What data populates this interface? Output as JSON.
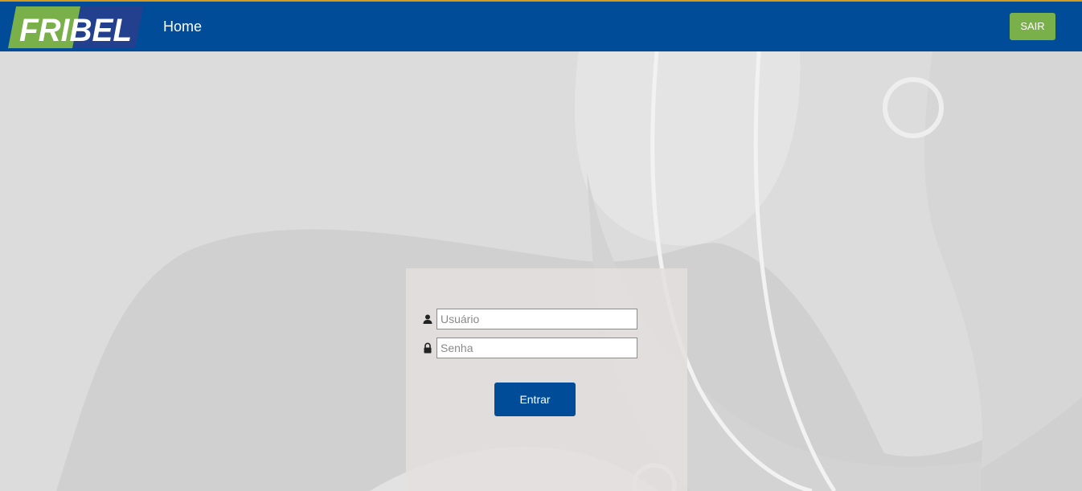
{
  "brand": {
    "logo_text": "FRIBEL",
    "colors": {
      "navbar": "#004c98",
      "logo_green": "#7ab04a",
      "logo_navy": "#23408e",
      "top_border": "#d49a1c"
    }
  },
  "nav": {
    "home_label": "Home",
    "sair_label": "SAIR"
  },
  "login": {
    "username": {
      "placeholder": "Usuário",
      "value": "",
      "icon": "user-icon"
    },
    "password": {
      "placeholder": "Senha",
      "value": "",
      "icon": "lock-icon"
    },
    "submit_label": "Entrar"
  }
}
